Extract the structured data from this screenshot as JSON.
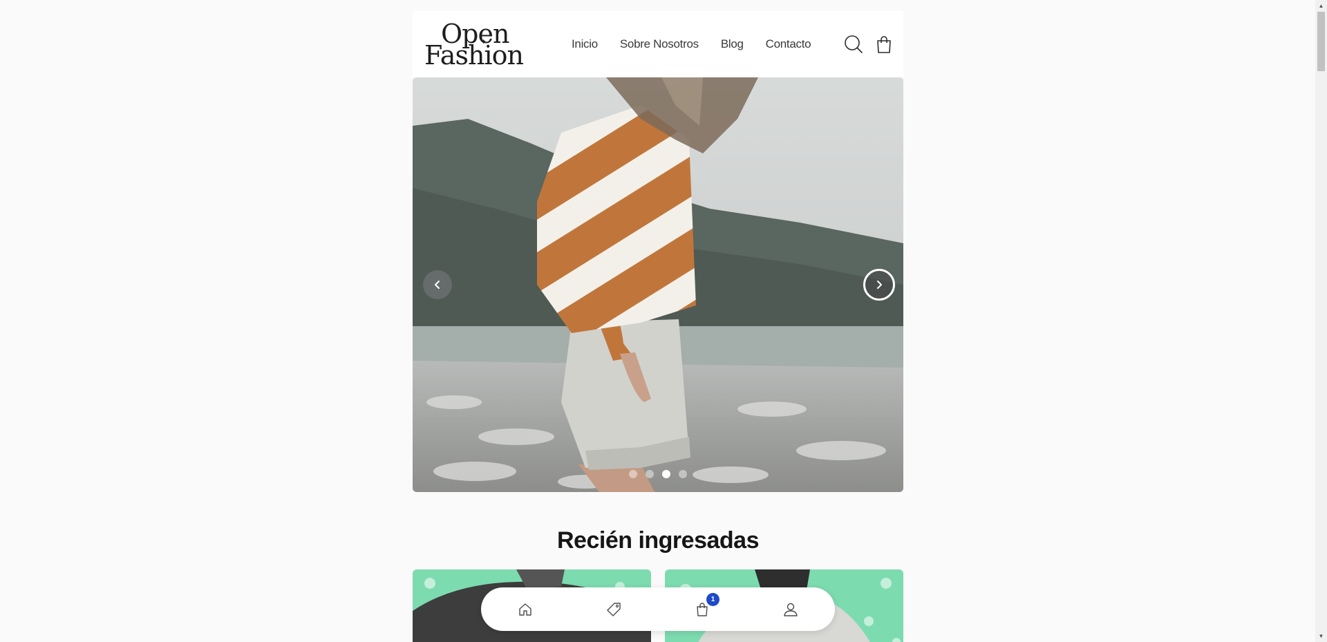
{
  "brand": {
    "logo_line1": "Open",
    "logo_line2": "Fashion"
  },
  "nav": {
    "items": [
      {
        "label": "Inicio"
      },
      {
        "label": "Sobre Nosotros"
      },
      {
        "label": "Blog"
      },
      {
        "label": "Contacto"
      }
    ]
  },
  "header_icons": {
    "search": "search-icon",
    "cart": "shopping-bag-icon"
  },
  "hero": {
    "slide_count": 4,
    "active_slide": 3,
    "prev_icon": "chevron-left-icon",
    "next_icon": "chevron-right-icon"
  },
  "section": {
    "title": "Recién ingresadas"
  },
  "bottom_nav": {
    "items": [
      {
        "icon": "home-icon"
      },
      {
        "icon": "tag-icon"
      },
      {
        "icon": "shopping-bag-icon",
        "badge": "1"
      },
      {
        "icon": "user-icon"
      }
    ]
  },
  "colors": {
    "background": "#fafafa",
    "badge": "#1f49c7",
    "text": "#161616",
    "product_bg": "#7ddbb0"
  }
}
